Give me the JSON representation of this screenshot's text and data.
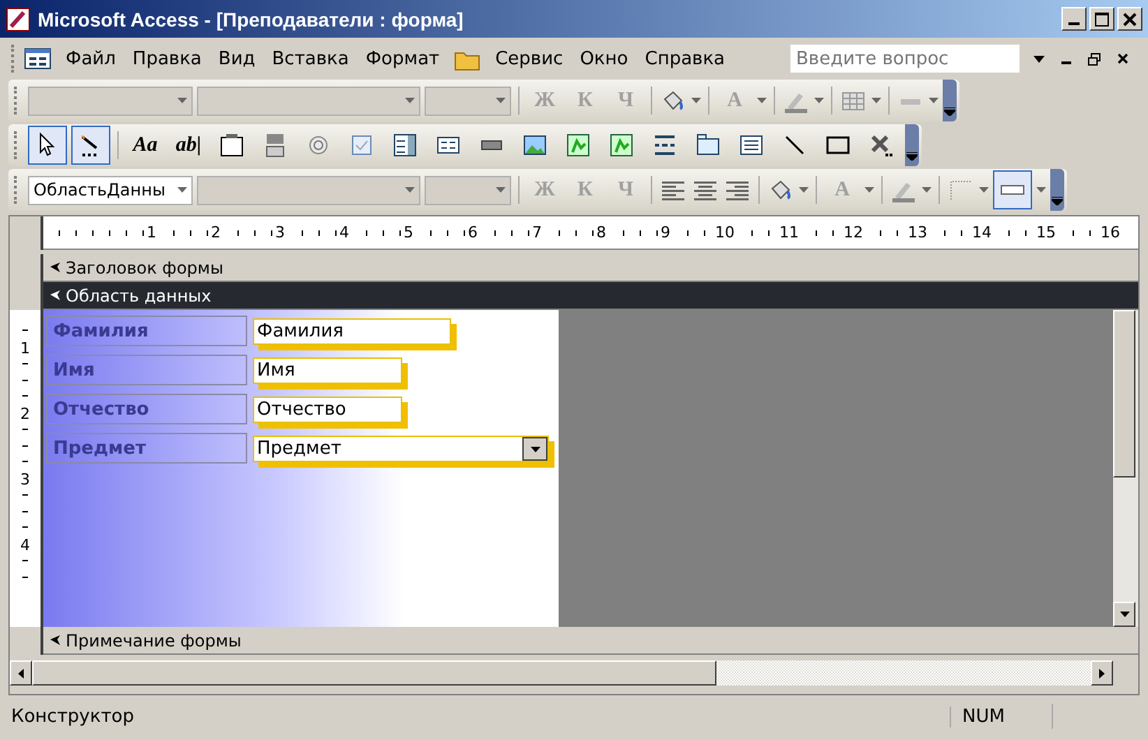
{
  "window": {
    "title": "Microsoft Access - [Преподаватели : форма]"
  },
  "menu_bar": {
    "items": [
      "Файл",
      "Правка",
      "Вид",
      "Вставка",
      "Формат",
      "Сервис",
      "Окно",
      "Справка"
    ],
    "help_search": {
      "placeholder": "Введите вопрос"
    }
  },
  "toolbar_formatting_1": {
    "buttons": [
      {
        "label": "Ж",
        "disabled": true
      },
      {
        "label": "К",
        "disabled": true
      },
      {
        "label": "Ч",
        "disabled": true
      },
      {
        "label": "A",
        "disabled": true
      }
    ]
  },
  "toolbox": {
    "items": [
      {
        "kind": "pointer",
        "selected": true
      },
      {
        "kind": "wizard",
        "selected": true
      },
      {
        "kind": "text",
        "label": "Aa",
        "selected": false
      },
      {
        "kind": "text",
        "label": "ab|",
        "selected": false
      },
      {
        "kind": "frame",
        "selected": false
      },
      {
        "kind": "toggle",
        "selected": false
      },
      {
        "kind": "radio",
        "selected": false
      },
      {
        "kind": "checkbox",
        "selected": false
      },
      {
        "kind": "combo",
        "selected": false
      },
      {
        "kind": "list",
        "selected": false
      },
      {
        "kind": "button",
        "selected": false
      },
      {
        "kind": "image",
        "selected": false
      },
      {
        "kind": "object",
        "selected": false
      },
      {
        "kind": "object",
        "selected": false
      },
      {
        "kind": "pagebreak",
        "selected": false
      },
      {
        "kind": "tab",
        "selected": false
      },
      {
        "kind": "subform",
        "selected": false
      },
      {
        "kind": "line",
        "selected": false
      },
      {
        "kind": "rectangle",
        "selected": false
      },
      {
        "kind": "tools",
        "selected": false
      }
    ]
  },
  "toolbar_formatting_2": {
    "object_box": "ОбластьДанны",
    "buttons": [
      {
        "label": "Ж",
        "disabled": true
      },
      {
        "label": "К",
        "disabled": true
      },
      {
        "label": "Ч",
        "disabled": true
      },
      {
        "label": "A",
        "disabled": true
      }
    ]
  },
  "ruler": {
    "marks": [
      "1",
      "2",
      "3",
      "4",
      "5",
      "6",
      "7",
      "8",
      "9",
      "10",
      "11",
      "12",
      "13",
      "14",
      "15",
      "16"
    ],
    "vertical_marks": [
      "1",
      "2",
      "3",
      "4"
    ]
  },
  "sections": [
    {
      "label": "Заголовок формы",
      "selected": false
    },
    {
      "label": "Область данных",
      "selected": true
    }
  ],
  "controls": [
    {
      "label": "Фамилия",
      "value": "Фамилия",
      "kind": "text"
    },
    {
      "label": "Имя",
      "value": "Имя",
      "kind": "text"
    },
    {
      "label": "Отчество",
      "value": "Отчество",
      "kind": "text"
    },
    {
      "label": "Предмет",
      "value": "Предмет",
      "kind": "combo"
    }
  ],
  "footer_section": {
    "label": "Примечание формы",
    "selected": false
  },
  "status_bar": {
    "mode": "Конструктор",
    "indicator": "NUM"
  }
}
